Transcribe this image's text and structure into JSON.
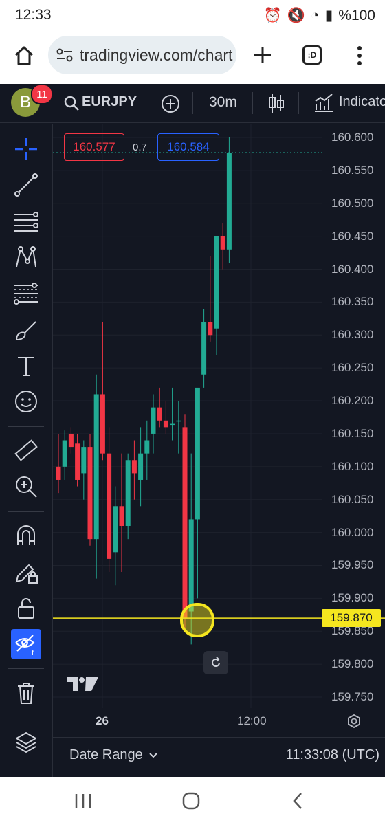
{
  "status_bar": {
    "time": "12:33",
    "battery": "%100"
  },
  "browser": {
    "url": "tradingview.com/chart",
    "tab_label": ":D"
  },
  "toolbar": {
    "avatar_letter": "B",
    "notification_count": "11",
    "symbol": "EURJPY",
    "interval": "30m",
    "indicators_label": "Indicators"
  },
  "quote": {
    "sell": "160.577",
    "spread": "0.7",
    "buy": "160.584"
  },
  "price_scale": [
    "160.600",
    "160.550",
    "160.500",
    "160.450",
    "160.400",
    "160.350",
    "160.300",
    "160.250",
    "160.200",
    "160.150",
    "160.100",
    "160.050",
    "160.000",
    "159.950",
    "159.900",
    "159.850",
    "159.800",
    "159.750"
  ],
  "current_price": "159.870",
  "time_axis": [
    "26",
    "12:00"
  ],
  "bottom": {
    "date_range": "Date Range",
    "clock": "11:33:08 (UTC)"
  },
  "colors": {
    "up": "#22ab94",
    "down": "#f23645",
    "price_line": "#f5e61f",
    "bg": "#131722"
  },
  "chart_data": {
    "type": "candlestick",
    "symbol": "EURJPY",
    "interval": "30m",
    "ylim": [
      159.73,
      160.62
    ],
    "candles": [
      {
        "o": 160.1,
        "h": 160.15,
        "l": 160.06,
        "c": 160.08
      },
      {
        "o": 160.1,
        "h": 160.155,
        "l": 160.08,
        "c": 160.14
      },
      {
        "o": 160.15,
        "h": 160.16,
        "l": 160.12,
        "c": 160.13
      },
      {
        "o": 160.135,
        "h": 160.15,
        "l": 160.07,
        "c": 160.08
      },
      {
        "o": 160.09,
        "h": 160.14,
        "l": 160.05,
        "c": 160.13
      },
      {
        "o": 160.13,
        "h": 160.15,
        "l": 159.98,
        "c": 159.99
      },
      {
        "o": 159.99,
        "h": 160.24,
        "l": 159.93,
        "c": 160.21
      },
      {
        "o": 160.21,
        "h": 160.32,
        "l": 160.11,
        "c": 160.12
      },
      {
        "o": 160.12,
        "h": 160.16,
        "l": 159.94,
        "c": 159.96
      },
      {
        "o": 159.97,
        "h": 160.07,
        "l": 159.92,
        "c": 160.04
      },
      {
        "o": 160.04,
        "h": 160.12,
        "l": 159.94,
        "c": 160.01
      },
      {
        "o": 160.01,
        "h": 160.12,
        "l": 159.99,
        "c": 160.11
      },
      {
        "o": 160.11,
        "h": 160.14,
        "l": 160.05,
        "c": 160.09
      },
      {
        "o": 160.08,
        "h": 160.16,
        "l": 160.04,
        "c": 160.12
      },
      {
        "o": 160.12,
        "h": 160.17,
        "l": 160.08,
        "c": 160.14
      },
      {
        "o": 160.15,
        "h": 160.21,
        "l": 160.12,
        "c": 160.19
      },
      {
        "o": 160.19,
        "h": 160.22,
        "l": 160.16,
        "c": 160.17
      },
      {
        "o": 160.17,
        "h": 160.2,
        "l": 160.15,
        "c": 160.16
      },
      {
        "o": 160.165,
        "h": 160.22,
        "l": 160.14,
        "c": 160.165
      },
      {
        "o": 160.17,
        "h": 160.2,
        "l": 160.12,
        "c": 160.17
      },
      {
        "o": 160.16,
        "h": 160.18,
        "l": 159.85,
        "c": 159.87
      },
      {
        "o": 159.88,
        "h": 160.12,
        "l": 159.83,
        "c": 160.02
      },
      {
        "o": 160.02,
        "h": 160.18,
        "l": 159.9,
        "c": 160.22
      },
      {
        "o": 160.24,
        "h": 160.34,
        "l": 160.22,
        "c": 160.32
      },
      {
        "o": 160.32,
        "h": 160.42,
        "l": 160.29,
        "c": 160.3
      },
      {
        "o": 160.31,
        "h": 160.45,
        "l": 160.27,
        "c": 160.45
      },
      {
        "o": 160.45,
        "h": 160.47,
        "l": 160.4,
        "c": 160.43
      },
      {
        "o": 160.43,
        "h": 160.6,
        "l": 160.41,
        "c": 160.577
      }
    ]
  }
}
